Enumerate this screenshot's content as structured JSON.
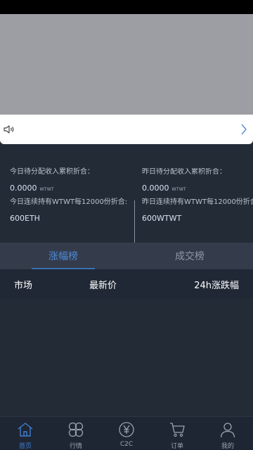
{
  "notice": {
    "speaker_icon": "speaker-icon",
    "arrow_icon": "chevron-right-icon"
  },
  "stats": {
    "left": {
      "label": "今日待分配收入累积折合：",
      "value": "0.0000",
      "unit": "WTWT",
      "label2": "今日连续持有WTWT每12000份折合:",
      "value2": "600ETH"
    },
    "right": {
      "label": "昨日待分配收入累积折合：",
      "value": "0.0000",
      "unit": "WTWT",
      "label2": "昨日连续持有WTWT每12000份折合:",
      "value2": "600WTWT"
    }
  },
  "tabs": [
    {
      "label": "涨幅榜",
      "active": true
    },
    {
      "label": "成交榜",
      "active": false
    }
  ],
  "table": {
    "columns": [
      "市场",
      "最新价",
      "24h涨跌幅"
    ]
  },
  "nav": [
    {
      "label": "首页",
      "icon": "home-icon",
      "active": true
    },
    {
      "label": "行情",
      "icon": "market-icon",
      "active": false
    },
    {
      "label": "C2C",
      "icon": "yen-icon",
      "active": false
    },
    {
      "label": "订单",
      "icon": "cart-icon",
      "active": false
    },
    {
      "label": "我的",
      "icon": "user-icon",
      "active": false
    }
  ],
  "colors": {
    "accent": "#3f7ed1",
    "background": "#232b37",
    "tab_bar": "#343b4b"
  }
}
